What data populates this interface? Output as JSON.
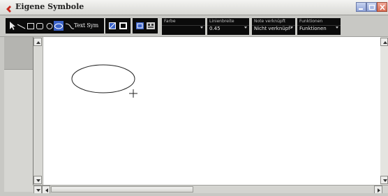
{
  "window": {
    "title": "Eigene Symbole",
    "controls": [
      "minimize-icon",
      "maximize-icon",
      "close-icon"
    ]
  },
  "toolbar": {
    "tools": [
      {
        "name": "pointer-tool",
        "icon": "arrow-pointer-icon"
      },
      {
        "name": "line-tool",
        "icon": "line-icon"
      },
      {
        "name": "rectangle-tool",
        "icon": "rectangle-icon"
      },
      {
        "name": "filled-rectangle-tool",
        "icon": "filled-rectangle-icon"
      },
      {
        "name": "circle-tool",
        "icon": "circle-icon"
      },
      {
        "name": "ellipse-tool",
        "icon": "ellipse-icon"
      },
      {
        "name": "curve-tool",
        "icon": "curve-icon"
      }
    ],
    "text_tool_label": "Text Sym",
    "fields": {
      "color": {
        "label": "Farbe",
        "value": ""
      },
      "line_width": {
        "label": "Linienbreite",
        "value": "0.45"
      },
      "note_link": {
        "label": "Note verknüpft",
        "value": "Nicht verknüpf-"
      },
      "functions": {
        "label": "Funktionen",
        "value": "Funktionen"
      }
    }
  },
  "colors": {
    "toolbar_dark": "#0b0b0b",
    "window_gray": "#c8c8c4",
    "canvas": "#ffffff",
    "selected_tool": "#3a62c8"
  }
}
